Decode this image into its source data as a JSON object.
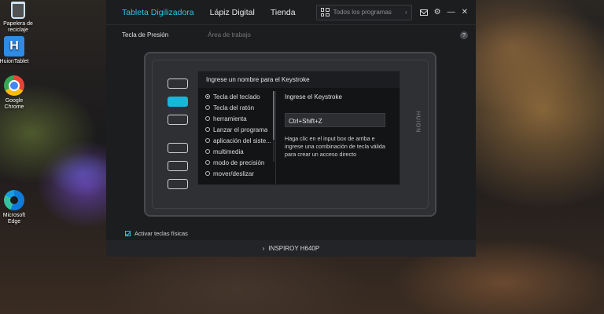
{
  "desktop": {
    "icons": [
      {
        "label": "Papelera de reciclaje",
        "icon": "recycle-bin-icon"
      },
      {
        "label": "HuionTablet",
        "icon": "huion-icon"
      },
      {
        "label": "Google Chrome",
        "icon": "chrome-icon"
      },
      {
        "label": "Microsoft Edge",
        "icon": "edge-icon"
      }
    ]
  },
  "app": {
    "tabs": [
      {
        "label": "Tableta Digilizadora",
        "active": true
      },
      {
        "label": "Lápiz Digital",
        "active": false
      },
      {
        "label": "Tienda",
        "active": false
      }
    ],
    "search": {
      "placeholder": "Todos los programas"
    },
    "accent_color": "#28c4e8",
    "subtabs": [
      {
        "label": "Tecla de Presión",
        "active": true
      },
      {
        "label": "Área de trabajo",
        "active": false
      }
    ],
    "help_label": "?",
    "tablet": {
      "brand": "HUION",
      "express_keys_count": 6,
      "active_key_index": 1
    },
    "dialog": {
      "title": "Ingrese un nombre para el Keystroke",
      "options": [
        {
          "label": "Tecla del teclado",
          "selected": true
        },
        {
          "label": "Tecla del ratón",
          "selected": false
        },
        {
          "label": "herramienta",
          "selected": false
        },
        {
          "label": "Lanzar el programa",
          "selected": false
        },
        {
          "label": "aplicación del siste...",
          "selected": false
        },
        {
          "label": "multimedia",
          "selected": false
        },
        {
          "label": "modo de precisión",
          "selected": false
        },
        {
          "label": "mover/deslizar",
          "selected": false
        }
      ],
      "keystroke_title": "Ingrese el Keystroke",
      "keystroke_value": "Ctrl+Shift+Z",
      "keystroke_help": "Haga clic en el input box de arriba e ingrese una combinación de tecla válida para crear un acceso directo"
    },
    "activate_label": "Activar teclas físicas",
    "activate_checked": true,
    "device_name": "INSPIROY H640P"
  }
}
